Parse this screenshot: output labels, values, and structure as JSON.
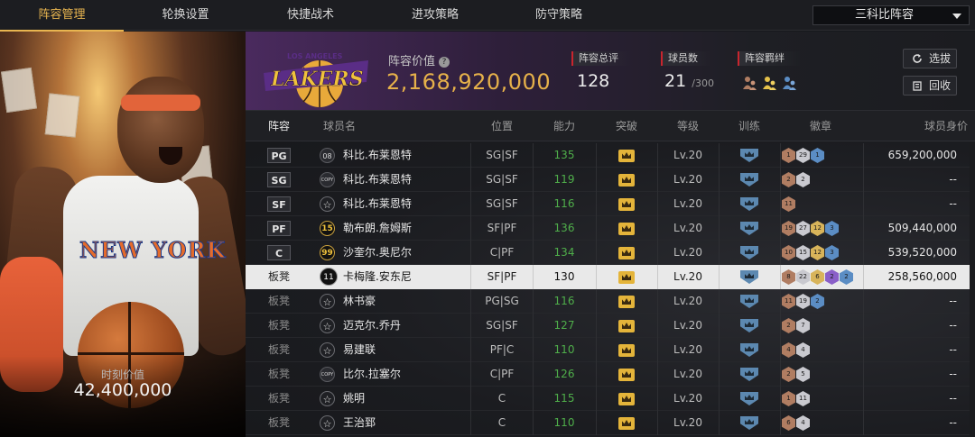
{
  "nav": {
    "tabs": [
      "阵容管理",
      "轮换设置",
      "快捷战术",
      "进攻策略",
      "防守策略"
    ],
    "active_tab": 0,
    "team_select": "三科比阵容"
  },
  "player_card": {
    "value_label": "时刻价值",
    "value": "42,400,000",
    "jersey_text": "NEW YORK"
  },
  "header": {
    "lineup_value_label": "阵容价值",
    "help_icon": "?",
    "lineup_value": "2,168,920,000",
    "overall_label": "阵容总评",
    "overall_value": "128",
    "players_label": "球员数",
    "players_value": "21",
    "players_max": "/300",
    "bond_label": "阵容羁绊",
    "select_button": "选拔",
    "recycle_button": "回收"
  },
  "table": {
    "headers": [
      "阵容",
      "球员名",
      "位置",
      "能力",
      "突破",
      "等级",
      "训练",
      "徽章",
      "球员身价"
    ],
    "rows": [
      {
        "slot": "PG",
        "icon": "08",
        "icon_type": "num",
        "name": "科比.布莱恩特",
        "pos": "SG|SF",
        "ovr": "135",
        "lv": "Lv.20",
        "badges": [
          {
            "t": "bronze",
            "v": "1"
          },
          {
            "t": "silver",
            "v": "29"
          },
          {
            "t": "blue",
            "v": "1"
          }
        ],
        "salary": "659,200,000"
      },
      {
        "slot": "SG",
        "icon": "COPY",
        "icon_type": "copy",
        "name": "科比.布莱恩特",
        "pos": "SG|SF",
        "ovr": "119",
        "lv": "Lv.20",
        "badges": [
          {
            "t": "bronze",
            "v": "2"
          },
          {
            "t": "silver",
            "v": "2"
          }
        ],
        "salary": "--"
      },
      {
        "slot": "SF",
        "icon": "☆",
        "icon_type": "star",
        "name": "科比.布莱恩特",
        "pos": "SG|SF",
        "ovr": "116",
        "lv": "Lv.20",
        "badges": [
          {
            "t": "bronze",
            "v": "11"
          }
        ],
        "salary": "--"
      },
      {
        "slot": "PF",
        "icon": "15",
        "icon_type": "gold",
        "name": "勒布朗.詹姆斯",
        "pos": "SF|PF",
        "ovr": "136",
        "lv": "Lv.20",
        "badges": [
          {
            "t": "bronze",
            "v": "19"
          },
          {
            "t": "silver",
            "v": "27"
          },
          {
            "t": "gold",
            "v": "12"
          },
          {
            "t": "blue",
            "v": "3"
          }
        ],
        "salary": "509,440,000"
      },
      {
        "slot": "C",
        "icon": "99",
        "icon_type": "gold",
        "name": "沙奎尔.奥尼尔",
        "pos": "C|PF",
        "ovr": "134",
        "lv": "Lv.20",
        "badges": [
          {
            "t": "bronze",
            "v": "10"
          },
          {
            "t": "silver",
            "v": "15"
          },
          {
            "t": "gold",
            "v": "12"
          },
          {
            "t": "blue",
            "v": "3"
          }
        ],
        "salary": "539,520,000"
      },
      {
        "slot": "板凳",
        "icon": "11",
        "icon_type": "big",
        "name": "卡梅隆.安东尼",
        "pos": "SF|PF",
        "ovr": "130",
        "lv": "Lv.20",
        "badges": [
          {
            "t": "bronze",
            "v": "8"
          },
          {
            "t": "silver",
            "v": "22"
          },
          {
            "t": "gold",
            "v": "6"
          },
          {
            "t": "purple",
            "v": "2"
          },
          {
            "t": "blue",
            "v": "2"
          }
        ],
        "salary": "258,560,000",
        "selected": true
      },
      {
        "slot": "板凳",
        "icon": "☆",
        "icon_type": "star",
        "name": "林书豪",
        "pos": "PG|SG",
        "ovr": "116",
        "lv": "Lv.20",
        "badges": [
          {
            "t": "bronze",
            "v": "11"
          },
          {
            "t": "silver",
            "v": "19"
          },
          {
            "t": "blue",
            "v": "2"
          }
        ],
        "salary": "--"
      },
      {
        "slot": "板凳",
        "icon": "☆",
        "icon_type": "star",
        "name": "迈克尔.乔丹",
        "pos": "SG|SF",
        "ovr": "127",
        "lv": "Lv.20",
        "badges": [
          {
            "t": "bronze",
            "v": "2"
          },
          {
            "t": "silver",
            "v": "7"
          }
        ],
        "salary": "--"
      },
      {
        "slot": "板凳",
        "icon": "☆",
        "icon_type": "star",
        "name": "易建联",
        "pos": "PF|C",
        "ovr": "110",
        "lv": "Lv.20",
        "badges": [
          {
            "t": "bronze",
            "v": "4"
          },
          {
            "t": "silver",
            "v": "4"
          }
        ],
        "salary": "--"
      },
      {
        "slot": "板凳",
        "icon": "COPY",
        "icon_type": "copy",
        "name": "比尔.拉塞尔",
        "pos": "C|PF",
        "ovr": "126",
        "lv": "Lv.20",
        "badges": [
          {
            "t": "bronze",
            "v": "2"
          },
          {
            "t": "silver",
            "v": "5"
          }
        ],
        "salary": "--"
      },
      {
        "slot": "板凳",
        "icon": "☆",
        "icon_type": "star",
        "name": "姚明",
        "pos": "C",
        "ovr": "115",
        "lv": "Lv.20",
        "badges": [
          {
            "t": "bronze",
            "v": "1"
          },
          {
            "t": "silver",
            "v": "11"
          }
        ],
        "salary": "--"
      },
      {
        "slot": "板凳",
        "icon": "☆",
        "icon_type": "star",
        "name": "王治郅",
        "pos": "C",
        "ovr": "110",
        "lv": "Lv.20",
        "badges": [
          {
            "t": "bronze",
            "v": "6"
          },
          {
            "t": "silver",
            "v": "4"
          }
        ],
        "salary": "--"
      }
    ]
  }
}
